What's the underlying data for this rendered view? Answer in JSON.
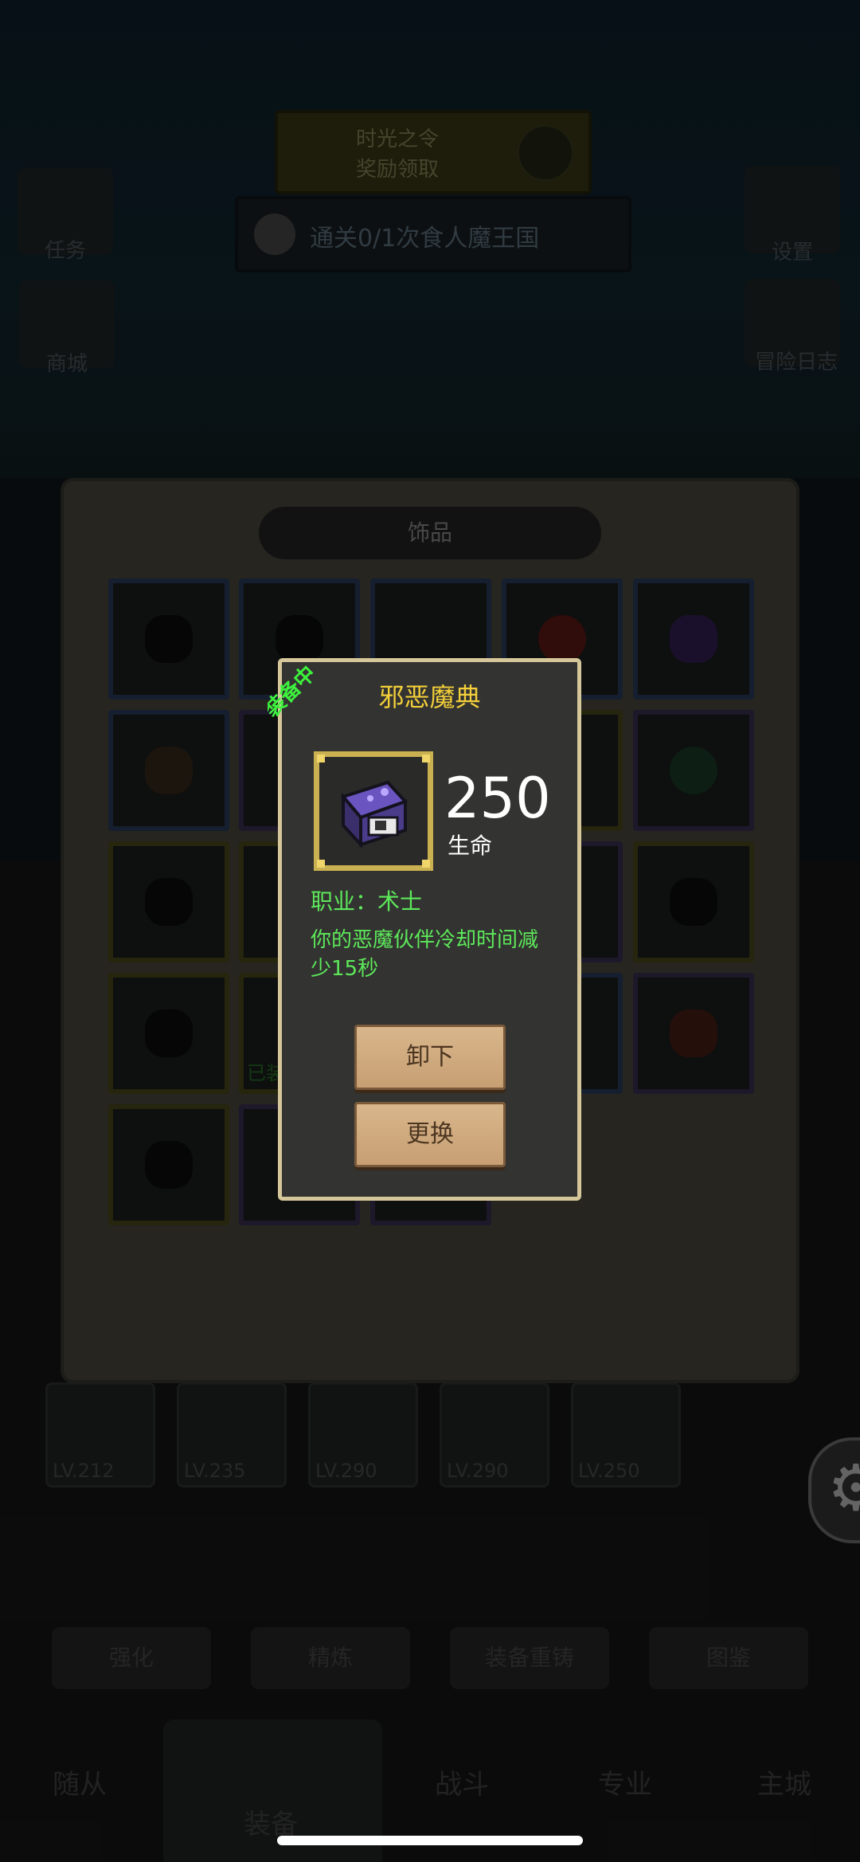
{
  "background": {
    "quest_title_1": "时光之令",
    "quest_title_2": "奖励领取",
    "quest_progress": "通关0/1次食人魔王国",
    "side_left": [
      "任务",
      "商城"
    ],
    "side_right": [
      "设置",
      "冒险日志"
    ]
  },
  "panel": {
    "tab_label": "饰品",
    "equipped_badge": "已装"
  },
  "equipment_bar": {
    "levels": [
      "LV.212",
      "LV.235",
      "LV.290",
      "LV.290",
      "LV.250"
    ]
  },
  "actions": [
    "强化",
    "精炼",
    "装备重铸",
    "图鉴"
  ],
  "nav": {
    "items": [
      "随从",
      "装备",
      "战斗",
      "专业",
      "主城"
    ],
    "active": "装备"
  },
  "modal": {
    "badge": "装备中",
    "title": "邪恶魔典",
    "stat_value": "250",
    "stat_label": "生命",
    "class_text": "职业：术士",
    "description": "你的恶魔伙伴冷却时间减少15秒",
    "unequip_label": "卸下",
    "replace_label": "更换",
    "title_color": "#f3cf3a",
    "effect_color": "#5de85a"
  },
  "icons": {
    "item": "demon-tome-icon",
    "settings": "gear-icon"
  }
}
